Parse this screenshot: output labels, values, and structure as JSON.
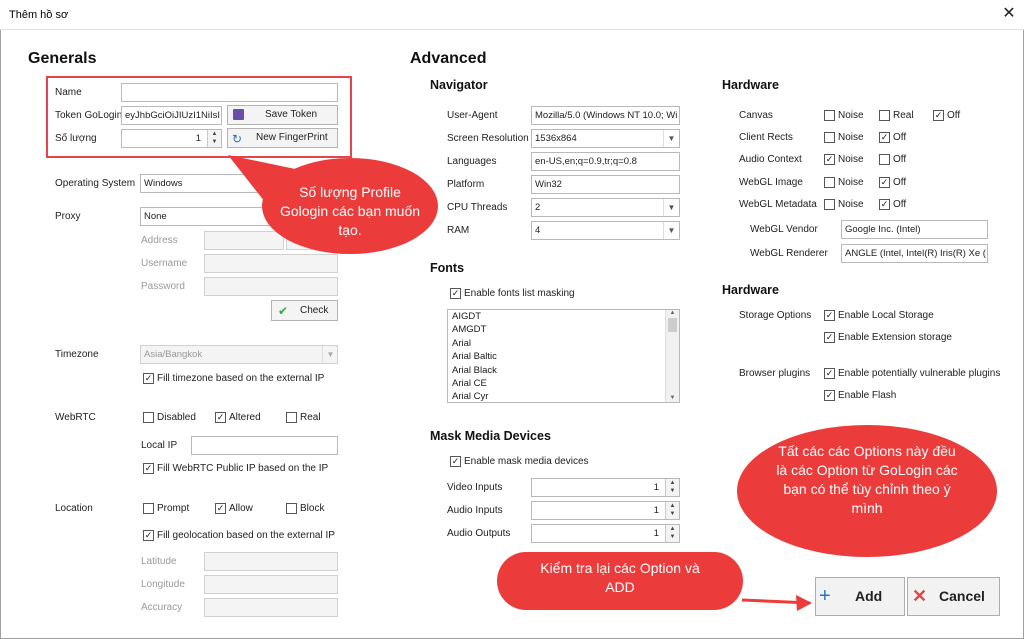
{
  "window": {
    "title": "Thêm hồ sơ",
    "close_glyph": "✕"
  },
  "generals": {
    "heading": "Generals",
    "name_label": "Name",
    "name_value": "",
    "token_label": "Token GoLogin",
    "token_value": "eyJhbGciOiJIUzI1NiIsI",
    "save_token": "Save Token",
    "qty_label": "Số lượng",
    "qty_value": "1",
    "new_fingerprint": "New FingerPrint",
    "os_label": "Operating System",
    "os_value": "Windows",
    "proxy_label": "Proxy",
    "proxy_value": "None",
    "address_label": "Address",
    "username_label": "Username",
    "password_label": "Password",
    "check_button": "Check",
    "timezone_label": "Timezone",
    "timezone_value": "Asia/Bangkok",
    "fill_timezone": "Fill timezone based on the external IP",
    "webrtc_label": "WebRTC",
    "webrtc_disabled": "Disabled",
    "webrtc_altered": "Altered",
    "webrtc_real": "Real",
    "local_ip_label": "Local IP",
    "fill_webrtc": "Fill WebRTC Public IP based on the IP",
    "location_label": "Location",
    "loc_prompt": "Prompt",
    "loc_allow": "Allow",
    "loc_block": "Block",
    "fill_geo": "Fill geolocation based on the external IP",
    "latitude_label": "Latitude",
    "longitude_label": "Longitude",
    "accuracy_label": "Accuracy"
  },
  "advanced": {
    "heading": "Advanced",
    "navigator_heading": "Navigator",
    "ua_label": "User-Agent",
    "ua_value": "Mozilla/5.0 (Windows NT 10.0; Wi",
    "res_label": "Screen Resolution",
    "res_value": "1536x864",
    "lang_label": "Languages",
    "lang_value": "en-US,en;q=0.9,tr;q=0.8",
    "platform_label": "Platform",
    "platform_value": "Win32",
    "cpu_label": "CPU Threads",
    "cpu_value": "2",
    "ram_label": "RAM",
    "ram_value": "4",
    "fonts_heading": "Fonts",
    "fonts_masking": "Enable fonts list masking",
    "fonts_list": [
      "AIGDT",
      "AMGDT",
      "Arial",
      "Arial Baltic",
      "Arial Black",
      "Arial CE",
      "Arial Cyr"
    ],
    "media_heading": "Mask Media Devices",
    "media_enable": "Enable mask media devices",
    "video_label": "Video Inputs",
    "video_value": "1",
    "audio_in_label": "Audio Inputs",
    "audio_in_value": "1",
    "audio_out_label": "Audio Outputs",
    "audio_out_value": "1"
  },
  "hardware": {
    "heading": "Hardware",
    "noise": "Noise",
    "real": "Real",
    "off": "Off",
    "canvas_label": "Canvas",
    "client_rects_label": "Client Rects",
    "audio_context_label": "Audio Context",
    "webgl_image_label": "WebGL Image",
    "webgl_meta_label": "WebGL Metadata",
    "vendor_label": "WebGL Vendor",
    "vendor_value": "Google Inc. (Intel)",
    "renderer_label": "WebGL Renderer",
    "renderer_value": "ANGLE (Intel, Intel(R) Iris(R) Xe (",
    "heading2": "Hardware",
    "storage_label": "Storage Options",
    "local_storage": "Enable Local Storage",
    "ext_storage": "Enable Extension storage",
    "plugins_label": "Browser plugins",
    "vuln_plugins": "Enable potentially vulnerable plugins",
    "flash": "Enable Flash"
  },
  "actions": {
    "add": "Add",
    "cancel": "Cancel"
  },
  "callouts": {
    "qty_note": "Số lượng Profile Gologin các bạn muốn tạo.",
    "options_note": "Tất các các Options này đều là các Option từ GoLogin các bạn có thể tùy chỉnh theo ý mình",
    "check_note": "Kiểm tra lại các Option và ADD"
  },
  "colors": {
    "callout_red": "#ec3b3b",
    "highlight_border": "#e8434a"
  }
}
